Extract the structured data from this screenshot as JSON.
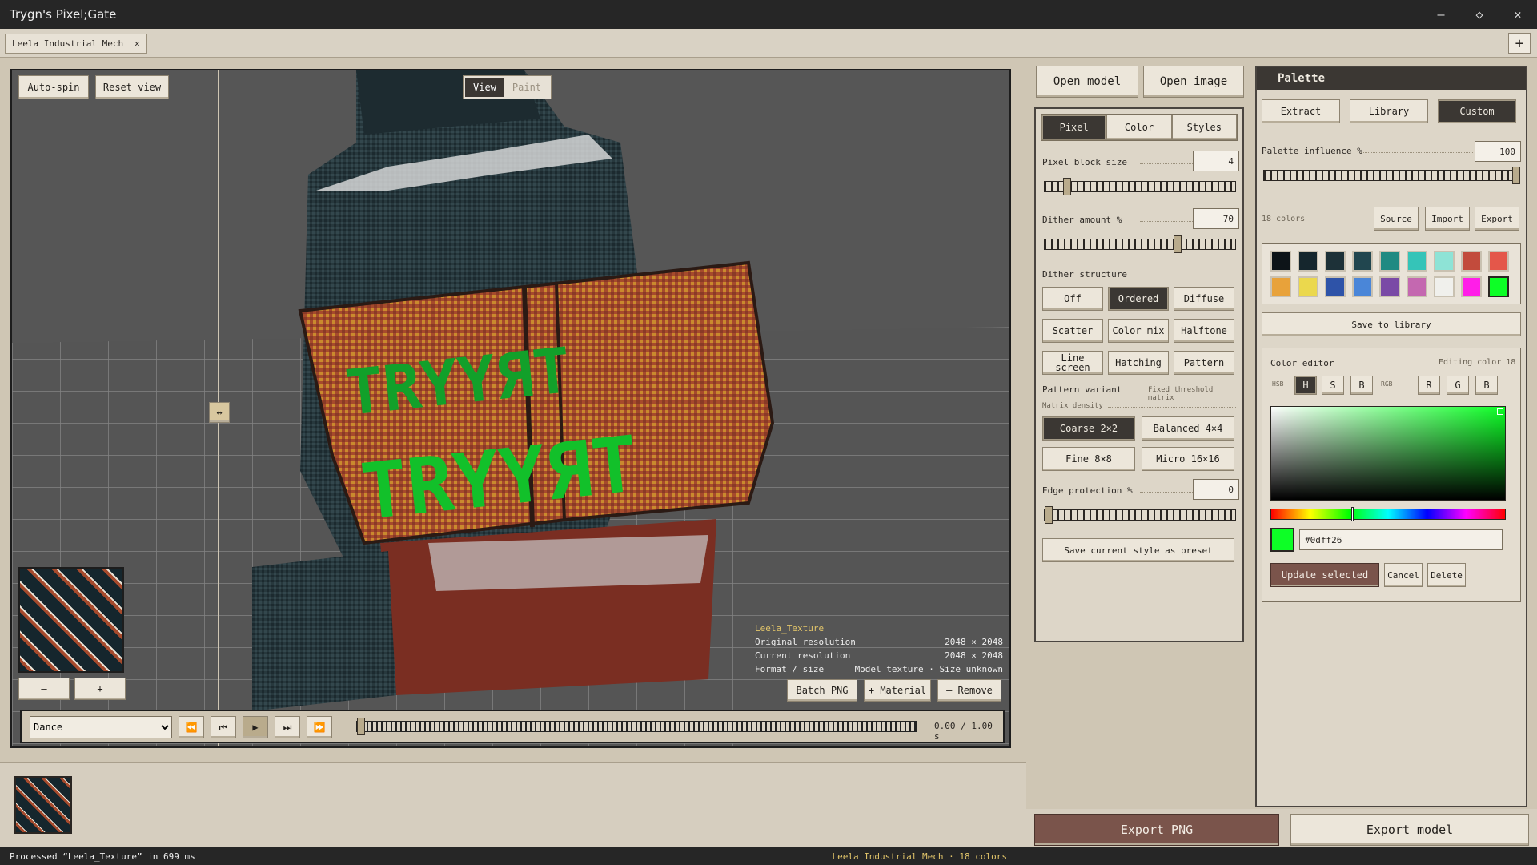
{
  "window": {
    "title": "Trygn's Pixel;Gate",
    "controls": [
      "–",
      "◇",
      "✕"
    ]
  },
  "tabs": [
    {
      "label": "Leela Industrial Mech",
      "close": "×"
    }
  ],
  "add_tab": "+",
  "viewport": {
    "auto_spin": "Auto-spin",
    "reset_view": "Reset view",
    "mode_view": "View",
    "mode_paint": "Paint",
    "splitter": "↔",
    "minus": "–",
    "plus": "+",
    "texture_name": "Leela_Texture",
    "info": [
      {
        "label": "Original resolution",
        "value": "2048 × 2048"
      },
      {
        "label": "Current resolution",
        "value": "2048 × 2048"
      },
      {
        "label": "Format / size",
        "value": "Model texture · Size unknown"
      }
    ],
    "batch_png": "Batch PNG",
    "add_material": "+ Material",
    "remove": "– Remove"
  },
  "timeline": {
    "animation": "Dance",
    "time": "0.00 / 1.00 s",
    "progress": 0.0
  },
  "status": {
    "left": "Processed “Leela_Texture” in 699 ms",
    "right": "Leela Industrial Mech · 18 colors"
  },
  "pixel_panel": {
    "open_model": "Open model",
    "open_image": "Open image",
    "tabs": [
      "Pixel",
      "Color",
      "Styles"
    ],
    "active_tab": "Pixel",
    "block_size_label": "Pixel block size",
    "block_size": "4",
    "block_size_frac": 0.1,
    "dither_label": "Dither amount %",
    "dither": "70",
    "dither_frac": 0.7,
    "structure_label": "Dither structure",
    "structures": [
      "Off",
      "Ordered",
      "Diffuse",
      "Scatter",
      "Color mix",
      "Halftone",
      "Line screen",
      "Hatching",
      "Pattern"
    ],
    "active_structure": "Ordered",
    "variant_label": "Pattern variant",
    "variant_value": "Fixed threshold matrix",
    "density_label": "Matrix density",
    "densities": [
      "Coarse 2×2",
      "Balanced 4×4",
      "Fine 8×8",
      "Micro 16×16"
    ],
    "active_density": "Coarse 2×2",
    "edge_label": "Edge protection %",
    "edge": "0",
    "edge_frac": 0.0,
    "save_preset": "Save current style as preset"
  },
  "palette_panel": {
    "title": "Palette",
    "tabs": [
      "Extract",
      "Library",
      "Custom"
    ],
    "active_tab": "Custom",
    "influence_label": "Palette influence %",
    "influence": "100",
    "influence_frac": 1.0,
    "count": "18 colors",
    "source": "Source",
    "import": "Import",
    "export": "Export",
    "colors": [
      "#0d1418",
      "#15262d",
      "#1d3138",
      "#21464f",
      "#1f8a82",
      "#35c4b8",
      "#8ee3d6",
      "#c24b3c",
      "#e4574a",
      "#e8a23a",
      "#ebd84d",
      "#2e53a8",
      "#4a86d8",
      "#7a4aa6",
      "#c468b0",
      "#f0f0ec",
      "#ff1ee8",
      "#0dff26"
    ],
    "save_library": "Save to library",
    "editor_title": "Color editor",
    "editing": "Editing color 18",
    "hsb": "HSB",
    "hsb_btns": [
      "H",
      "S",
      "B"
    ],
    "rgb": "RGB",
    "rgb_btns": [
      "R",
      "G",
      "B"
    ],
    "hex": "#0dff26",
    "update": "Update selected",
    "cancel": "Cancel",
    "delete": "Delete"
  },
  "export_png": "Export PNG",
  "export_model": "Export model"
}
